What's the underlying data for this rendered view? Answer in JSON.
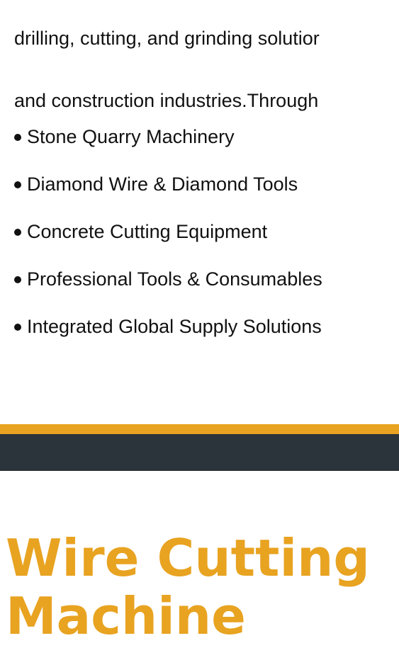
{
  "intro": {
    "line1": "drilling, cutting, and grinding solutior",
    "line2": "and construction industries.Through"
  },
  "features": [
    "Stone Quarry Machinery",
    "Diamond Wire & Diamond Tools",
    "Concrete Cutting Equipment",
    "Professional Tools & Consumables",
    "Integrated Global Supply Solutions"
  ],
  "hero": {
    "title_line1": "Wire Cutting",
    "title_line2": "Machine"
  },
  "colors": {
    "accent": "#e8a321",
    "band": "#2c343b",
    "text": "#111111",
    "background": "#ffffff"
  }
}
